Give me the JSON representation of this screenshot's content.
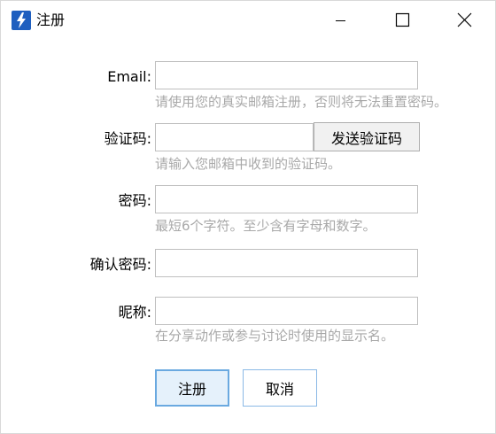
{
  "window": {
    "title": "注册"
  },
  "form": {
    "email": {
      "label": "Email:",
      "value": "",
      "hint": "请使用您的真实邮箱注册，否则将无法重置密码。"
    },
    "code": {
      "label": "验证码:",
      "value": "",
      "send_button": "发送验证码",
      "hint": "请输入您邮箱中收到的验证码。"
    },
    "password": {
      "label": "密码:",
      "value": "",
      "hint": "最短6个字符。至少含有字母和数字。"
    },
    "confirm": {
      "label": "确认密码:",
      "value": ""
    },
    "nickname": {
      "label": "昵称:",
      "value": "",
      "hint": "在分享动作或参与讨论时使用的显示名。"
    }
  },
  "buttons": {
    "register": "注册",
    "cancel": "取消"
  },
  "colors": {
    "app_icon": "#1f5fbf",
    "hint_text": "#a8a8a8",
    "primary_border": "#6aa9e0",
    "primary_bg": "#e5f1fb"
  },
  "icons": {
    "app": "lightning-icon",
    "minimize": "minimize-icon",
    "maximize": "maximize-icon",
    "close": "close-icon"
  }
}
